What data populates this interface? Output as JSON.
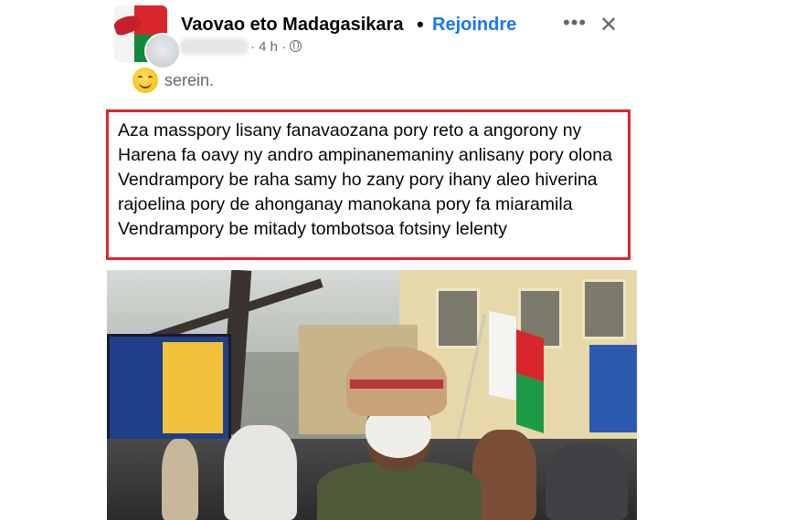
{
  "header": {
    "group_name": "Vaovao eto Madagasikara",
    "separator": "•",
    "join_label": "Rejoindre",
    "more_icon": "more-horizontal-icon",
    "close_icon": "close-icon"
  },
  "meta": {
    "time": "· 4 h ·",
    "audience_icon": "globe-icon"
  },
  "feeling": {
    "emoji_icon": "smiling-face-icon",
    "label": "serein."
  },
  "post": {
    "text": "Aza masspory lisany fanavaozana pory reto a angorony ny Harena fa oavy ny andro ampinanemaniny anlisany pory olona Vendrampory be raha samy ho zany pory ihany aleo hiverina rajoelina pory de ahonganay manokana pory fa miaramila Vendrampory be mitady tombotsoa fotsiny lelenty",
    "highlight_color": "#e0262b"
  },
  "colors": {
    "link": "#1877f2",
    "secondary_text": "#65676b"
  }
}
